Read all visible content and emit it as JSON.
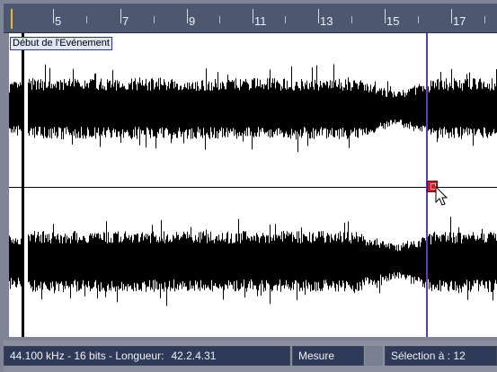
{
  "ruler": {
    "ticks": [
      {
        "label": "5"
      },
      {
        "label": "7"
      },
      {
        "label": "9"
      },
      {
        "label": "11"
      },
      {
        "label": "13"
      },
      {
        "label": "15"
      },
      {
        "label": "17"
      }
    ]
  },
  "event": {
    "label": "Début de l'Evénement"
  },
  "status": {
    "info_text": "44.100 kHz - 16 bits - Longueur:",
    "length_value": "42.2.4.31",
    "mode": "Mesure",
    "selection_label": "Sélection à :",
    "selection_value": "12"
  },
  "colors": {
    "waveform": "#000000",
    "playhead": "#5d3cae",
    "marker": "#c81e2a",
    "ruler_bg": "#4d5870",
    "status_bg": "#2f3a59"
  }
}
